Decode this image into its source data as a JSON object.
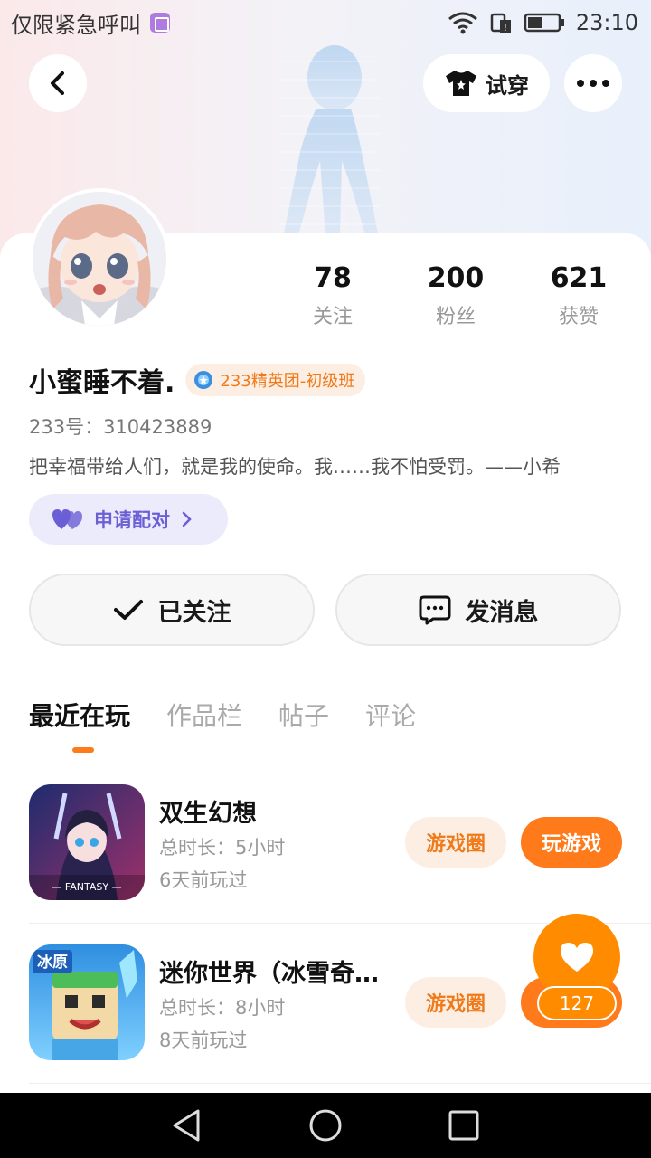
{
  "status_bar": {
    "carrier_text": "仅限紧急呼叫",
    "time": "23:10",
    "icons": [
      "sim-icon",
      "wifi-icon",
      "data-icon",
      "battery-icon"
    ]
  },
  "header": {
    "try_on_label": "试穿",
    "icons": [
      "back-icon",
      "shirt-icon",
      "more-icon"
    ]
  },
  "profile": {
    "name": "小蜜睡不着.",
    "badge": "233精英团-初级班",
    "uid": "233号：310423889",
    "bio": "把幸福带给人们，就是我的使命。我……我不怕受罚。——小希",
    "match_label": "申请配对",
    "stats": [
      {
        "value": "78",
        "label": "关注"
      },
      {
        "value": "200",
        "label": "粉丝"
      },
      {
        "value": "621",
        "label": "获赞"
      }
    ]
  },
  "actions": {
    "follow_label": "已关注",
    "message_label": "发消息"
  },
  "tabs": [
    "最近在玩",
    "作品栏",
    "帖子",
    "评论"
  ],
  "games": [
    {
      "name": "双生幻想",
      "duration": "总时长：5小时",
      "last_played": "6天前玩过",
      "circle_label": "游戏圈",
      "play_label": "玩游戏",
      "icon_text": "— FANTASY —"
    },
    {
      "name": "迷你世界（冰雪奇…",
      "duration": "总时长：8小时",
      "last_played": "8天前玩过",
      "circle_label": "游戏圈",
      "icon_text": "冰原"
    }
  ],
  "like": {
    "count": "127"
  },
  "colors": {
    "accent": "#ff7a1a",
    "match_purple": "#6b5fd6",
    "badge_bg": "#fdeee3"
  }
}
